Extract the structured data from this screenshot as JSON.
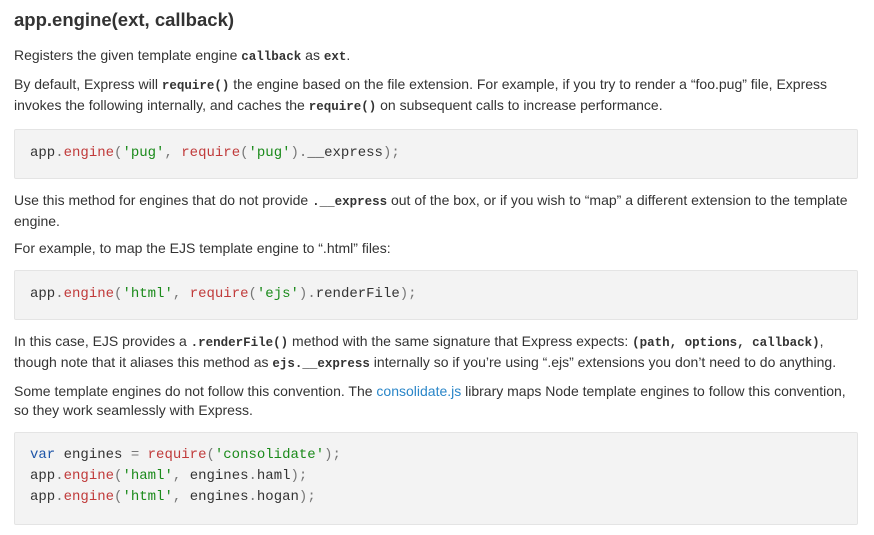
{
  "heading": "app.engine(ext, callback)",
  "p1": {
    "a": "Registers the given template engine ",
    "code1": "callback",
    "b": " as ",
    "code2": "ext",
    "c": "."
  },
  "p2": {
    "a": "By default, Express will ",
    "code1": "require()",
    "b": " the engine based on the file extension. For example, if you try to render a “foo.pug” file, Express invokes the following internally, and caches the ",
    "code2": "require()",
    "c": " on subsequent calls to increase performance."
  },
  "code1": {
    "app": "app",
    "dot": ".",
    "engine": "engine",
    "open": "(",
    "str1": "'pug'",
    "comma": ", ",
    "require": "require",
    "open2": "(",
    "str2": "'pug'",
    "close2": ")",
    "dot2": ".",
    "prop": "__express",
    "close": ");"
  },
  "p3": {
    "a": "Use this method for engines that do not provide ",
    "code1": ".__express",
    "b": " out of the box, or if you wish to “map” a different extension to the template engine."
  },
  "p4": "For example, to map the EJS template engine to “.html” files:",
  "code2": {
    "app": "app",
    "dot": ".",
    "engine": "engine",
    "open": "(",
    "str1": "'html'",
    "comma": ", ",
    "require": "require",
    "open2": "(",
    "str2": "'ejs'",
    "close2": ")",
    "dot2": ".",
    "prop": "renderFile",
    "close": ");"
  },
  "p5": {
    "a": "In this case, EJS provides a ",
    "code1": ".renderFile()",
    "b": " method with the same signature that Express expects: ",
    "code2": "(path, options, callback)",
    "c": ", though note that it aliases this method as ",
    "code3": "ejs.__express",
    "d": " internally so if you’re using “.ejs” extensions you don’t need to do anything."
  },
  "p6": {
    "a": "Some template engines do not follow this convention. The ",
    "link": "consolidate.js",
    "b": " library maps Node template engines to follow this convention, so they work seamlessly with Express."
  },
  "code3": {
    "l1_var": "var",
    "l1_name": " engines ",
    "l1_eq": "=",
    "l1_sp": " ",
    "l1_require": "require",
    "l1_open": "(",
    "l1_str": "'consolidate'",
    "l1_close": ");",
    "l2_app": "app",
    "l2_dot": ".",
    "l2_engine": "engine",
    "l2_open": "(",
    "l2_str": "'haml'",
    "l2_comma": ", ",
    "l2_obj": "engines",
    "l2_dot2": ".",
    "l2_prop": "haml",
    "l2_close": ");",
    "l3_app": "app",
    "l3_dot": ".",
    "l3_engine": "engine",
    "l3_open": "(",
    "l3_str": "'html'",
    "l3_comma": ", ",
    "l3_obj": "engines",
    "l3_dot2": ".",
    "l3_prop": "hogan",
    "l3_close": ");"
  },
  "colors": {
    "keyword": "#1e55a8",
    "function": "#c03a3a",
    "string": "#1a8a1a",
    "link": "#2a86c8",
    "code_bg": "#f3f3f3"
  }
}
